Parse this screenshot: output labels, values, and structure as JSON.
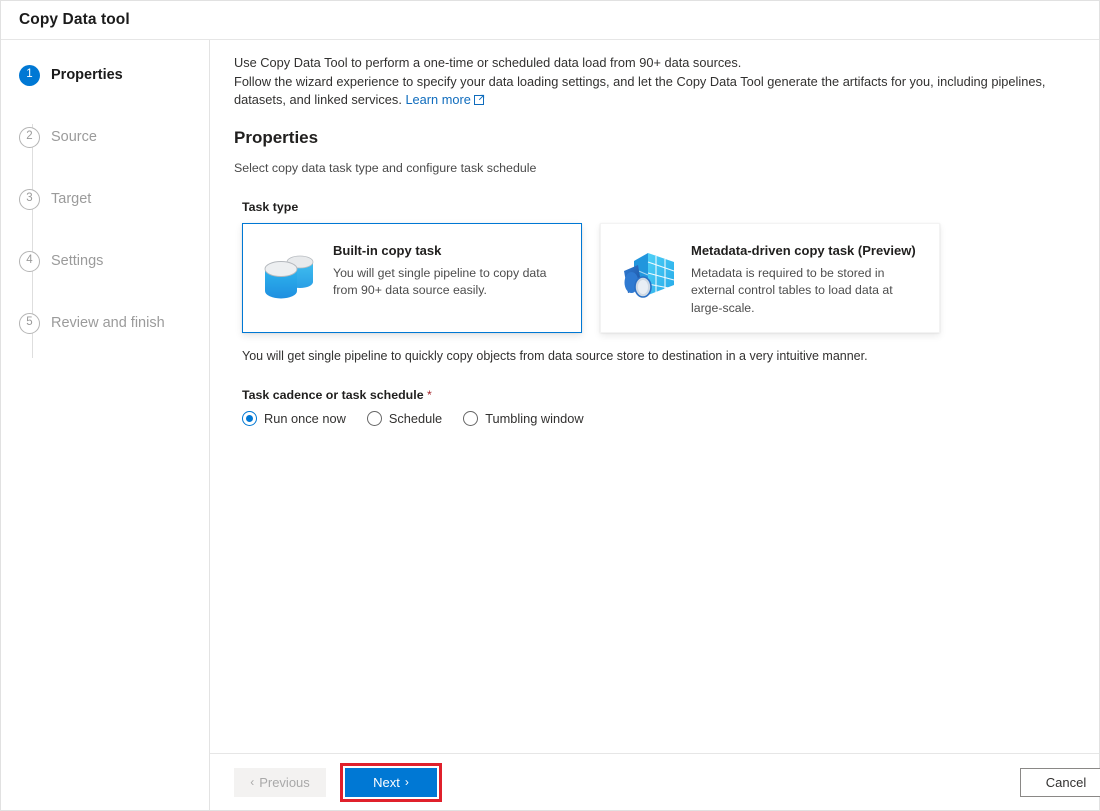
{
  "window": {
    "title": "Copy Data tool"
  },
  "sidebar": {
    "steps": [
      {
        "number": "1",
        "label": "Properties",
        "state": "active"
      },
      {
        "number": "2",
        "label": "Source",
        "state": "inactive"
      },
      {
        "number": "3",
        "label": "Target",
        "state": "inactive"
      },
      {
        "number": "4",
        "label": "Settings",
        "state": "inactive"
      },
      {
        "number": "5",
        "label": "Review and finish",
        "state": "inactive"
      }
    ]
  },
  "main": {
    "intro_line1": "Use Copy Data Tool to perform a one-time or scheduled data load from 90+ data sources.",
    "intro_line2": "Follow the wizard experience to specify your data loading settings, and let the Copy Data Tool generate the artifacts for you, including pipelines, datasets, and linked services.",
    "learn_more": "Learn more",
    "section_title": "Properties",
    "section_subtitle": "Select copy data task type and configure task schedule",
    "task_type_label": "Task type",
    "cards": [
      {
        "title": "Built-in copy task",
        "description": "You will get single pipeline to copy data from 90+ data source easily.",
        "icon": "database-cylinders-icon",
        "selected": true
      },
      {
        "title": "Metadata-driven copy task (Preview)",
        "description": "Metadata is required to be stored in external control tables to load data at large-scale.",
        "icon": "metadata-table-funnel-icon",
        "selected": false
      }
    ],
    "note": "You will get single pipeline to quickly copy objects from data source store to destination in a very intuitive manner.",
    "cadence_label": "Task cadence or task schedule",
    "cadence_required_mark": "*",
    "cadence_options": [
      {
        "label": "Run once now",
        "checked": true
      },
      {
        "label": "Schedule",
        "checked": false
      },
      {
        "label": "Tumbling window",
        "checked": false
      }
    ]
  },
  "footer": {
    "previous_label": "Previous",
    "next_label": "Next",
    "cancel_label": "Cancel",
    "previous_chevron": "‹",
    "next_chevron": "›"
  },
  "colors": {
    "accent": "#0078d4",
    "link": "#0f6cbd",
    "highlight_box": "#e0202b",
    "required_star": "#a4262c"
  }
}
